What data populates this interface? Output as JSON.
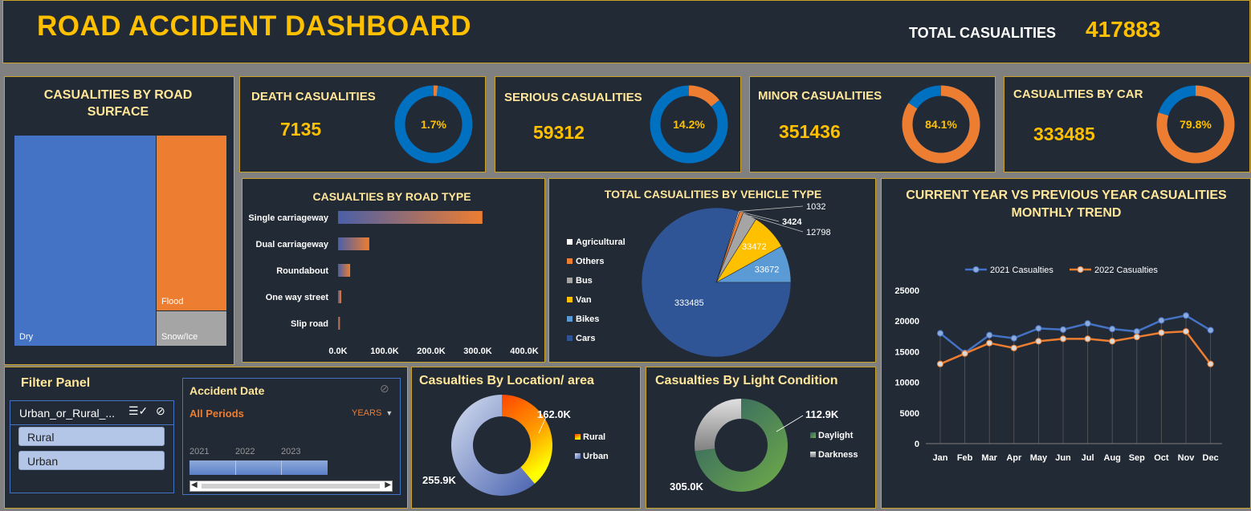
{
  "header": {
    "title": "ROAD ACCIDENT DASHBOARD",
    "total_label": "TOTAL CASUALITIES",
    "total_value": "417883"
  },
  "kpis": [
    {
      "title": "DEATH CASUALITIES",
      "value": "7135",
      "pct_label": "1.7%",
      "fraction": 0.017
    },
    {
      "title": "SERIOUS CASUALITIES",
      "value": "59312",
      "pct_label": "14.2%",
      "fraction": 0.142
    },
    {
      "title": "MINOR CASUALITIES",
      "value": "351436",
      "pct_label": "84.1%",
      "fraction": 0.841
    },
    {
      "title": "CASUALITIES BY CAR",
      "value": "333485",
      "pct_label": "79.8%",
      "fraction": 0.798
    }
  ],
  "colors": {
    "gold": "#ffc000",
    "cream": "#ffe699",
    "blue": "#0070c0",
    "orange": "#ed7d31",
    "bg": "#222a35",
    "border": "#c9a227"
  },
  "chart_data": [
    {
      "type": "treemap",
      "title": "CASUALITIES BY ROAD SURFACE",
      "categories": [
        "Dry",
        "Flood",
        "Snow/Ice"
      ],
      "colors": [
        "#4472c4",
        "#ed7d31",
        "#a5a5a5"
      ]
    },
    {
      "type": "bar",
      "orientation": "horizontal",
      "title": "CASUALTIES BY ROAD TYPE",
      "categories": [
        "Single carriageway",
        "Dual carriageway",
        "Roundabout",
        "One way street",
        "Slip road"
      ],
      "values": [
        310000,
        67000,
        26000,
        7000,
        4000
      ],
      "xlim": [
        0,
        400000
      ],
      "ticks": [
        "0.0K",
        "100.0K",
        "200.0K",
        "300.0K",
        "400.0K"
      ]
    },
    {
      "type": "pie",
      "title": "TOTAL CASUALITIES BY VEHICLE TYPE",
      "categories": [
        "Agricultural",
        "Others",
        "Bus",
        "Van",
        "Bikes",
        "Cars"
      ],
      "values": [
        1032,
        3424,
        12798,
        33472,
        33672,
        333485
      ],
      "labels": [
        "1032",
        "3424",
        "12798",
        "33472",
        "33672",
        "333485"
      ],
      "colors": [
        "#ffffff",
        "#ed7d31",
        "#a5a5a5",
        "#ffc000",
        "#5b9bd5",
        "#2f5597"
      ]
    },
    {
      "type": "line",
      "title": "CURRENT YEAR VS PREVIOUS YEAR CASUALITIES MONTHLY TREND",
      "categories": [
        "Jan",
        "Feb",
        "Mar",
        "Apr",
        "May",
        "Jun",
        "Jul",
        "Aug",
        "Sep",
        "Oct",
        "Nov",
        "Dec"
      ],
      "series": [
        {
          "name": "2021 Casualties",
          "color": "#4472c4",
          "values": [
            18000,
            14800,
            17700,
            17200,
            18800,
            18600,
            19600,
            18700,
            18300,
            20100,
            20900,
            18500
          ]
        },
        {
          "name": "2022 Casualties",
          "color": "#ed7d31",
          "values": [
            13000,
            14700,
            16400,
            15600,
            16700,
            17100,
            17100,
            16700,
            17400,
            18100,
            18300,
            13000
          ]
        }
      ],
      "ylim": [
        0,
        25000
      ],
      "yticks": [
        "0",
        "5000",
        "10000",
        "15000",
        "20000",
        "25000"
      ],
      "grid": false,
      "legend": "top"
    },
    {
      "type": "donut",
      "title": "Casualties By Location/ area",
      "categories": [
        "Rural",
        "Urban"
      ],
      "values": [
        162000,
        255900
      ],
      "labels": [
        "162.0K",
        "255.9K"
      ]
    },
    {
      "type": "donut",
      "title": "Casualties By Light Condition",
      "categories": [
        "Daylight",
        "Darkness"
      ],
      "values": [
        305000,
        112900
      ],
      "labels": [
        "305.0K",
        "112.9K"
      ]
    }
  ],
  "filter_panel": {
    "title": "Filter Panel",
    "slicer_header": "Urban_or_Rural_...",
    "items": [
      "Rural",
      "Urban"
    ],
    "timeline": {
      "title": "Accident Date",
      "period_label": "All Periods",
      "level": "YEARS",
      "years": [
        "2021",
        "2022",
        "2023"
      ]
    }
  }
}
